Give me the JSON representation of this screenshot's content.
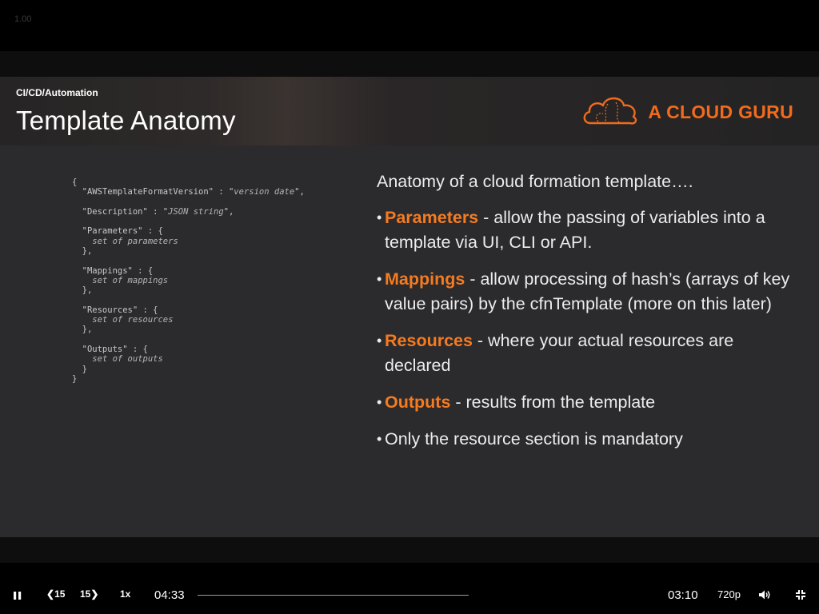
{
  "overlay": {
    "speed_indicator": "1.00"
  },
  "slide": {
    "category": "CI/CD/Automation",
    "title": "Template Anatomy",
    "brand": "A CLOUD GURU",
    "code_lines": [
      {
        "plain": "{",
        "italic": ""
      },
      {
        "plain": "  \"AWSTemplateFormatVersion\" : \"",
        "italic": "version date",
        "tail": "\","
      },
      {
        "plain": "",
        "italic": "",
        "gap": true
      },
      {
        "plain": "  \"Description\" : \"",
        "italic": "JSON string",
        "tail": "\","
      },
      {
        "plain": "",
        "italic": "",
        "gap": true
      },
      {
        "plain": "  \"Parameters\" : {",
        "italic": ""
      },
      {
        "plain": "    ",
        "italic": "set of parameters"
      },
      {
        "plain": "  },",
        "italic": ""
      },
      {
        "plain": "",
        "italic": "",
        "gap": true
      },
      {
        "plain": "  \"Mappings\" : {",
        "italic": ""
      },
      {
        "plain": "    ",
        "italic": "set of mappings"
      },
      {
        "plain": "  },",
        "italic": ""
      },
      {
        "plain": "",
        "italic": "",
        "gap": true
      },
      {
        "plain": "  \"Resources\" : {",
        "italic": ""
      },
      {
        "plain": "    ",
        "italic": "set of resources"
      },
      {
        "plain": "  },",
        "italic": ""
      },
      {
        "plain": "",
        "italic": "",
        "gap": true
      },
      {
        "plain": "  \"Outputs\" : {",
        "italic": ""
      },
      {
        "plain": "    ",
        "italic": "set of outputs"
      },
      {
        "plain": "  }",
        "italic": ""
      },
      {
        "plain": "}",
        "italic": ""
      }
    ],
    "intro": "Anatomy of a cloud formation template….",
    "bullets": [
      {
        "keyword": "Parameters",
        "text": " - allow the passing of variables into a template via UI, CLI or API."
      },
      {
        "keyword": "Mappings",
        "text": " - allow processing of hash’s (arrays of key value pairs) by the cfnTemplate (more on this later)"
      },
      {
        "keyword": "Resources",
        "text": " - where your actual resources are declared"
      },
      {
        "keyword": "Outputs",
        "text": " - results from the template"
      },
      {
        "keyword": "",
        "text": "Only the resource section is mandatory"
      }
    ]
  },
  "player": {
    "rewind_label": "15",
    "forward_label": "15",
    "speed_label": "1x",
    "elapsed": "04:33",
    "remaining": "03:10",
    "quality": "720p",
    "progress_fraction": 0.0,
    "icons": {
      "play_pause": "pause-icon",
      "rewind": "rewind-15-icon",
      "forward": "forward-15-icon",
      "volume": "volume-icon",
      "fullscreen": "exit-fullscreen-icon"
    },
    "brand_color": "#f47b20"
  }
}
